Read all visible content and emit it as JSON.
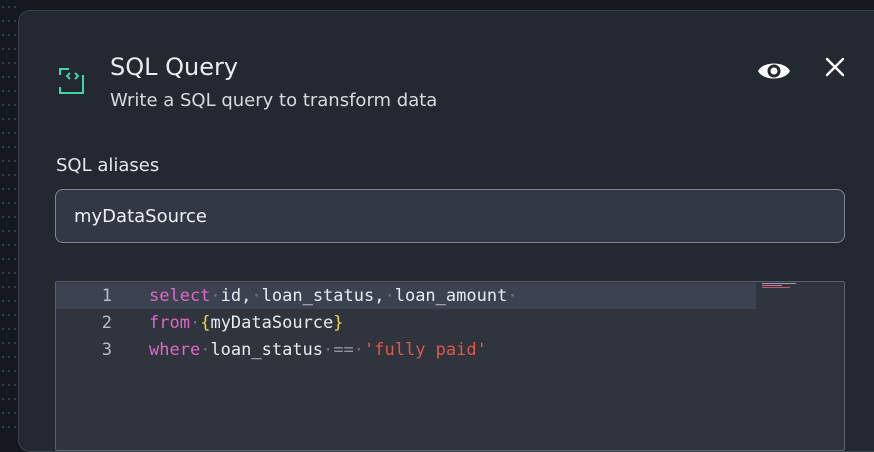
{
  "dialog": {
    "title": "SQL Query",
    "subtitle": "Write a SQL query to transform data",
    "icon": "code-bracket-icon",
    "actions": {
      "preview_icon": "eye-icon",
      "close_icon": "close-icon"
    },
    "accent_color": "#3fd6a8"
  },
  "aliases": {
    "label": "SQL aliases",
    "value": "myDataSource"
  },
  "editor": {
    "lines": [
      {
        "number": "1",
        "tokens": [
          "select",
          "id,",
          "loan_status,",
          "loan_amount"
        ]
      },
      {
        "number": "2",
        "tokens": [
          "from",
          "{",
          "myDataSource",
          "}"
        ]
      },
      {
        "number": "3",
        "tokens": [
          "where",
          "loan_status",
          "==",
          "'fully paid'"
        ]
      }
    ]
  }
}
